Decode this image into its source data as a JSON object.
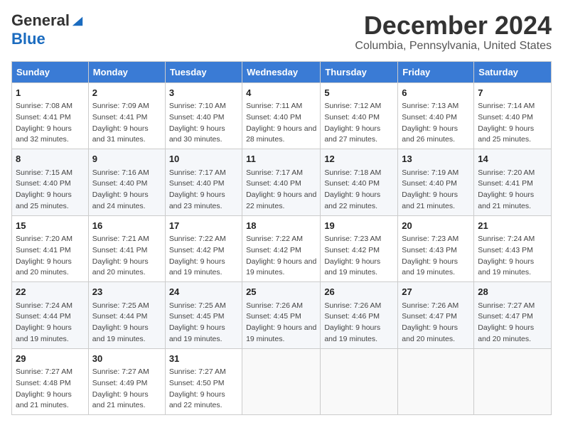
{
  "logo": {
    "line1": "General",
    "line2": "Blue"
  },
  "title": "December 2024",
  "subtitle": "Columbia, Pennsylvania, United States",
  "columns": [
    "Sunday",
    "Monday",
    "Tuesday",
    "Wednesday",
    "Thursday",
    "Friday",
    "Saturday"
  ],
  "weeks": [
    [
      {
        "day": "1",
        "sunrise": "Sunrise: 7:08 AM",
        "sunset": "Sunset: 4:41 PM",
        "daylight": "Daylight: 9 hours and 32 minutes."
      },
      {
        "day": "2",
        "sunrise": "Sunrise: 7:09 AM",
        "sunset": "Sunset: 4:41 PM",
        "daylight": "Daylight: 9 hours and 31 minutes."
      },
      {
        "day": "3",
        "sunrise": "Sunrise: 7:10 AM",
        "sunset": "Sunset: 4:40 PM",
        "daylight": "Daylight: 9 hours and 30 minutes."
      },
      {
        "day": "4",
        "sunrise": "Sunrise: 7:11 AM",
        "sunset": "Sunset: 4:40 PM",
        "daylight": "Daylight: 9 hours and 28 minutes."
      },
      {
        "day": "5",
        "sunrise": "Sunrise: 7:12 AM",
        "sunset": "Sunset: 4:40 PM",
        "daylight": "Daylight: 9 hours and 27 minutes."
      },
      {
        "day": "6",
        "sunrise": "Sunrise: 7:13 AM",
        "sunset": "Sunset: 4:40 PM",
        "daylight": "Daylight: 9 hours and 26 minutes."
      },
      {
        "day": "7",
        "sunrise": "Sunrise: 7:14 AM",
        "sunset": "Sunset: 4:40 PM",
        "daylight": "Daylight: 9 hours and 25 minutes."
      }
    ],
    [
      {
        "day": "8",
        "sunrise": "Sunrise: 7:15 AM",
        "sunset": "Sunset: 4:40 PM",
        "daylight": "Daylight: 9 hours and 25 minutes."
      },
      {
        "day": "9",
        "sunrise": "Sunrise: 7:16 AM",
        "sunset": "Sunset: 4:40 PM",
        "daylight": "Daylight: 9 hours and 24 minutes."
      },
      {
        "day": "10",
        "sunrise": "Sunrise: 7:17 AM",
        "sunset": "Sunset: 4:40 PM",
        "daylight": "Daylight: 9 hours and 23 minutes."
      },
      {
        "day": "11",
        "sunrise": "Sunrise: 7:17 AM",
        "sunset": "Sunset: 4:40 PM",
        "daylight": "Daylight: 9 hours and 22 minutes."
      },
      {
        "day": "12",
        "sunrise": "Sunrise: 7:18 AM",
        "sunset": "Sunset: 4:40 PM",
        "daylight": "Daylight: 9 hours and 22 minutes."
      },
      {
        "day": "13",
        "sunrise": "Sunrise: 7:19 AM",
        "sunset": "Sunset: 4:40 PM",
        "daylight": "Daylight: 9 hours and 21 minutes."
      },
      {
        "day": "14",
        "sunrise": "Sunrise: 7:20 AM",
        "sunset": "Sunset: 4:41 PM",
        "daylight": "Daylight: 9 hours and 21 minutes."
      }
    ],
    [
      {
        "day": "15",
        "sunrise": "Sunrise: 7:20 AM",
        "sunset": "Sunset: 4:41 PM",
        "daylight": "Daylight: 9 hours and 20 minutes."
      },
      {
        "day": "16",
        "sunrise": "Sunrise: 7:21 AM",
        "sunset": "Sunset: 4:41 PM",
        "daylight": "Daylight: 9 hours and 20 minutes."
      },
      {
        "day": "17",
        "sunrise": "Sunrise: 7:22 AM",
        "sunset": "Sunset: 4:42 PM",
        "daylight": "Daylight: 9 hours and 19 minutes."
      },
      {
        "day": "18",
        "sunrise": "Sunrise: 7:22 AM",
        "sunset": "Sunset: 4:42 PM",
        "daylight": "Daylight: 9 hours and 19 minutes."
      },
      {
        "day": "19",
        "sunrise": "Sunrise: 7:23 AM",
        "sunset": "Sunset: 4:42 PM",
        "daylight": "Daylight: 9 hours and 19 minutes."
      },
      {
        "day": "20",
        "sunrise": "Sunrise: 7:23 AM",
        "sunset": "Sunset: 4:43 PM",
        "daylight": "Daylight: 9 hours and 19 minutes."
      },
      {
        "day": "21",
        "sunrise": "Sunrise: 7:24 AM",
        "sunset": "Sunset: 4:43 PM",
        "daylight": "Daylight: 9 hours and 19 minutes."
      }
    ],
    [
      {
        "day": "22",
        "sunrise": "Sunrise: 7:24 AM",
        "sunset": "Sunset: 4:44 PM",
        "daylight": "Daylight: 9 hours and 19 minutes."
      },
      {
        "day": "23",
        "sunrise": "Sunrise: 7:25 AM",
        "sunset": "Sunset: 4:44 PM",
        "daylight": "Daylight: 9 hours and 19 minutes."
      },
      {
        "day": "24",
        "sunrise": "Sunrise: 7:25 AM",
        "sunset": "Sunset: 4:45 PM",
        "daylight": "Daylight: 9 hours and 19 minutes."
      },
      {
        "day": "25",
        "sunrise": "Sunrise: 7:26 AM",
        "sunset": "Sunset: 4:45 PM",
        "daylight": "Daylight: 9 hours and 19 minutes."
      },
      {
        "day": "26",
        "sunrise": "Sunrise: 7:26 AM",
        "sunset": "Sunset: 4:46 PM",
        "daylight": "Daylight: 9 hours and 19 minutes."
      },
      {
        "day": "27",
        "sunrise": "Sunrise: 7:26 AM",
        "sunset": "Sunset: 4:47 PM",
        "daylight": "Daylight: 9 hours and 20 minutes."
      },
      {
        "day": "28",
        "sunrise": "Sunrise: 7:27 AM",
        "sunset": "Sunset: 4:47 PM",
        "daylight": "Daylight: 9 hours and 20 minutes."
      }
    ],
    [
      {
        "day": "29",
        "sunrise": "Sunrise: 7:27 AM",
        "sunset": "Sunset: 4:48 PM",
        "daylight": "Daylight: 9 hours and 21 minutes."
      },
      {
        "day": "30",
        "sunrise": "Sunrise: 7:27 AM",
        "sunset": "Sunset: 4:49 PM",
        "daylight": "Daylight: 9 hours and 21 minutes."
      },
      {
        "day": "31",
        "sunrise": "Sunrise: 7:27 AM",
        "sunset": "Sunset: 4:50 PM",
        "daylight": "Daylight: 9 hours and 22 minutes."
      },
      null,
      null,
      null,
      null
    ]
  ]
}
